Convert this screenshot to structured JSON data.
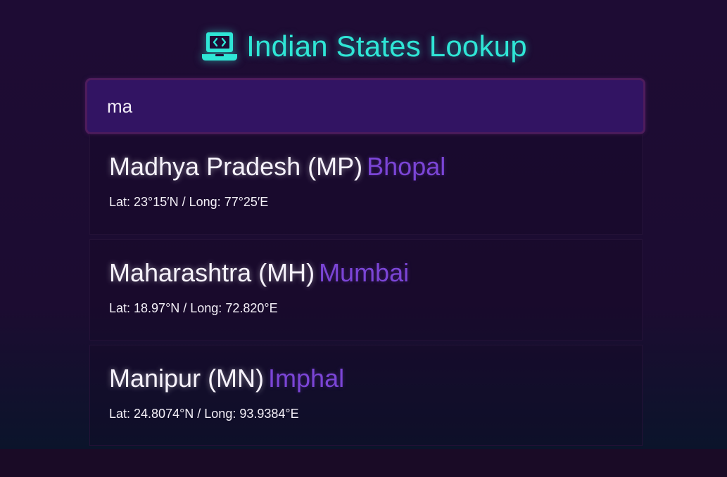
{
  "header": {
    "icon": "laptop-code-icon",
    "title": "Indian States Lookup",
    "accent_color": "#2fe6d6"
  },
  "search": {
    "value": "ma"
  },
  "results": [
    {
      "state": "Madhya Pradesh (MP)",
      "capital": "Bhopal",
      "coords": "Lat: 23°15′N / Long: 77°25′E"
    },
    {
      "state": "Maharashtra (MH)",
      "capital": "Mumbai",
      "coords": "Lat: 18.97°N / Long: 72.820°E"
    },
    {
      "state": "Manipur (MN)",
      "capital": "Imphal",
      "coords": "Lat: 24.8074°N / Long: 93.9384°E"
    }
  ],
  "colors": {
    "capital": "#7b45d6",
    "search_background": "#321463"
  }
}
